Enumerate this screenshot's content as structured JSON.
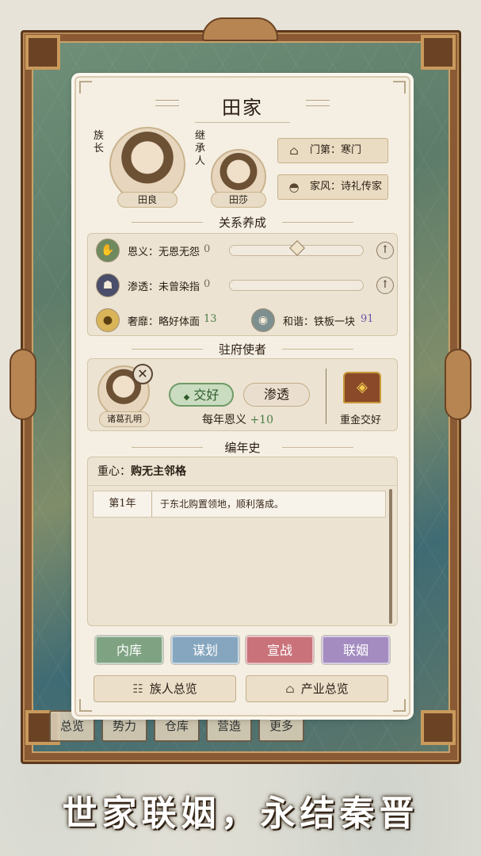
{
  "family": {
    "name": "田家",
    "leader_label": "族长",
    "heir_label": "继承人",
    "leader_name": "田良",
    "heir_name": "田莎",
    "rank": "门第：寒门",
    "style": "家风：诗礼传家"
  },
  "relations": {
    "heading": "关系养成",
    "favor": {
      "label": "恩义：无恩无怨",
      "value": 0,
      "level": 0.5
    },
    "infiltration": {
      "label": "渗透：未曾染指",
      "value": 0,
      "level": 0
    },
    "luxury": {
      "label": "奢靡：略好体面",
      "value": 13
    },
    "harmony": {
      "label": "和谐：铁板一块",
      "value": 91
    }
  },
  "envoy": {
    "heading": "驻府使者",
    "name": "诸葛孔明",
    "befriend_label": "交好",
    "infiltrate_label": "渗透",
    "yearly_text": "每年恩义",
    "yearly_value": "+10",
    "gift_label": "重金交好"
  },
  "chronicle": {
    "heading": "编年史",
    "focus_label": "重心：",
    "focus_value": "购无主邻格",
    "entries": [
      {
        "year": "第1年",
        "text": "于东北购置领地，顺利落成。"
      }
    ]
  },
  "actions": {
    "treasury": "内库",
    "scheme": "谋划",
    "war": "宣战",
    "marriage": "联姻",
    "clan_overview": "族人总览",
    "industry_overview": "产业总览"
  },
  "background_tabs": [
    "总览",
    "势力",
    "仓库",
    "营造",
    "更多"
  ],
  "slogan": "世家联姻，永结秦晋",
  "colors": {
    "treasury": "#7fa382",
    "scheme": "#86a6bf",
    "war": "#c9727a",
    "marriage": "#a48cc0",
    "befriend": "#c9dcc0"
  }
}
